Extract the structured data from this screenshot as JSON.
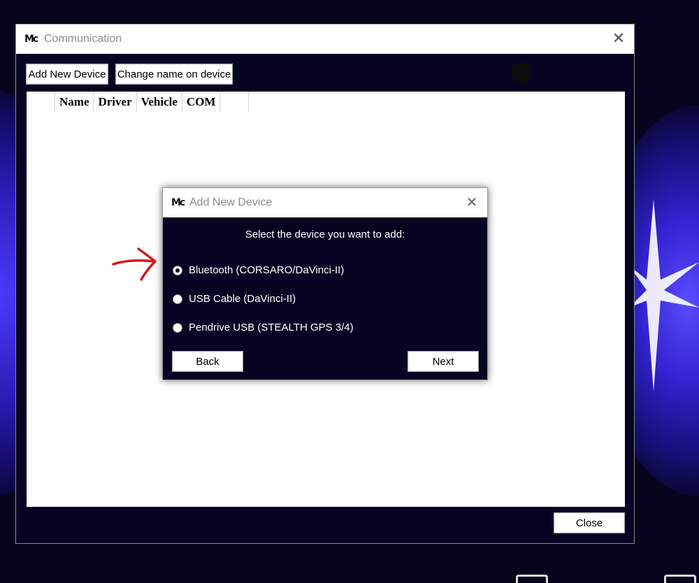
{
  "main_window": {
    "title": "Communication",
    "logo_icon": "mc-app-logo-icon",
    "toolbar": {
      "add_device_label": "Add New Device",
      "rename_device_label": "Change name on device"
    },
    "table": {
      "columns": [
        "Name",
        "Driver",
        "Vehicle",
        "COM"
      ],
      "rows": []
    },
    "close_label": "Close"
  },
  "dialog": {
    "title": "Add New Device",
    "prompt": "Select the device you want to add:",
    "options": [
      {
        "label": "Bluetooth (CORSARO/DaVinci-II)",
        "selected": true
      },
      {
        "label": "USB Cable (DaVinci-II)",
        "selected": false
      },
      {
        "label": "Pendrive USB (STEALTH GPS 3/4)",
        "selected": false
      }
    ],
    "back_label": "Back",
    "next_label": "Next"
  },
  "annotation": {
    "arrow_icon": "red-hand-drawn-arrow-icon",
    "arrow_color": "#d11a1a"
  },
  "colors": {
    "window_bg": "#050523",
    "desktop_glow": "#4d3bff"
  }
}
